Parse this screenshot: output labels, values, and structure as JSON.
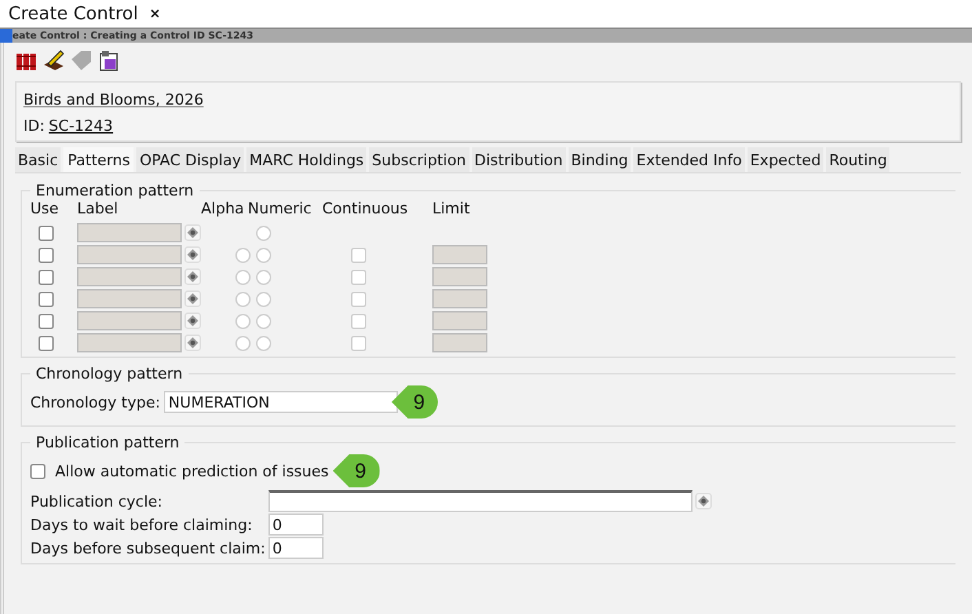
{
  "window_tab": {
    "title": "Create Control",
    "close": "×"
  },
  "title_bar": {
    "title": "eate Control : Creating a Control ID SC-1243"
  },
  "header": {
    "title": "Birds and Blooms, 2026",
    "id_label": "ID:",
    "id_value": "SC-1243"
  },
  "tabs": [
    {
      "label": "Basic",
      "selected": false
    },
    {
      "label": "Patterns",
      "selected": true
    },
    {
      "label": "OPAC Display",
      "selected": false
    },
    {
      "label": "MARC Holdings",
      "selected": false
    },
    {
      "label": "Subscription",
      "selected": false
    },
    {
      "label": "Distribution",
      "selected": false
    },
    {
      "label": "Binding",
      "selected": false
    },
    {
      "label": "Extended Info",
      "selected": false
    },
    {
      "label": "Expected",
      "selected": false
    },
    {
      "label": "Routing",
      "selected": false
    }
  ],
  "enumeration": {
    "legend": "Enumeration pattern",
    "columns": [
      "Use",
      "Label",
      "Alpha",
      "Numeric",
      "Continuous",
      "Limit"
    ],
    "rows": [
      {
        "kind": "numeric_only",
        "use_checked": false,
        "numeric_selected": false
      },
      {
        "kind": "full",
        "use_checked": false,
        "alpha_selected": false,
        "numeric_selected": false,
        "continuous_checked": false
      },
      {
        "kind": "full",
        "use_checked": false,
        "alpha_selected": false,
        "numeric_selected": false,
        "continuous_checked": false
      },
      {
        "kind": "full",
        "use_checked": false,
        "alpha_selected": false,
        "numeric_selected": false,
        "continuous_checked": false
      },
      {
        "kind": "full",
        "use_checked": false,
        "alpha_selected": false,
        "numeric_selected": false,
        "continuous_checked": false
      },
      {
        "kind": "full",
        "use_checked": false,
        "alpha_selected": false,
        "numeric_selected": false,
        "continuous_checked": false
      }
    ]
  },
  "chronology": {
    "legend": "Chronology pattern",
    "type_label": "Chronology type:",
    "type_value": "NUMERATION",
    "callout": "9"
  },
  "publication": {
    "legend": "Publication pattern",
    "auto_predict": {
      "label": "Allow automatic prediction of issues",
      "checked": false
    },
    "callout": "9",
    "cycle_label": "Publication cycle:",
    "wait_label": "Days to wait before claiming:",
    "wait_value": "0",
    "subsequent_label": "Days before subsequent claim:",
    "subsequent_value": "0"
  }
}
